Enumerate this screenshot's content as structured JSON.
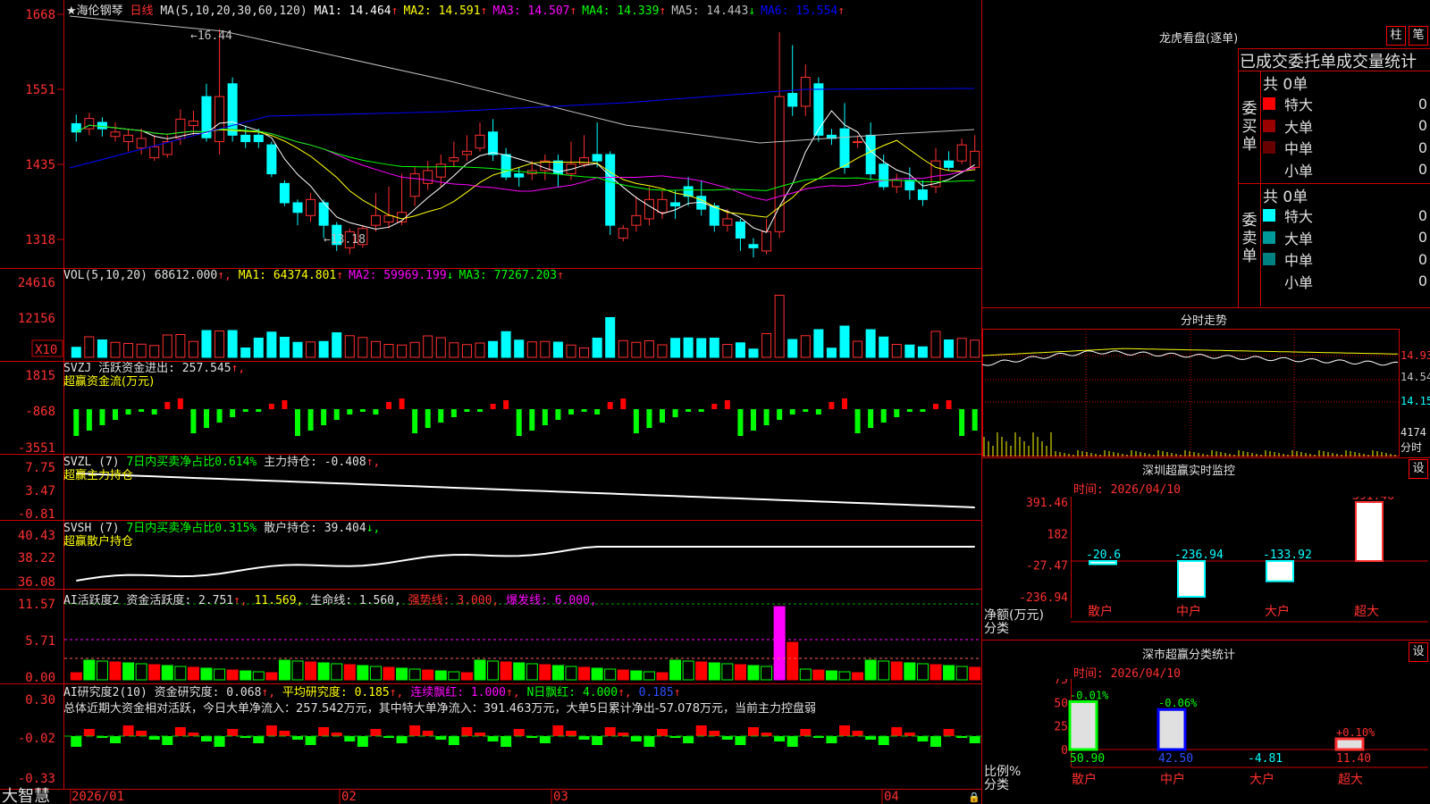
{
  "stock": {
    "name": "★海伦钢琴",
    "period": "日线",
    "ma_params": "MA(5,10,20,30,60,120)",
    "ma": [
      {
        "label": "MA1:",
        "value": "14.464",
        "arrow": "↑",
        "color": "#ffffff"
      },
      {
        "label": "MA2:",
        "value": "14.591",
        "arrow": "↑",
        "color": "#ffff00"
      },
      {
        "label": "MA3:",
        "value": "14.507",
        "arrow": "↑",
        "color": "#ff00ff"
      },
      {
        "label": "MA4:",
        "value": "14.339",
        "arrow": "↑",
        "color": "#00ff00"
      },
      {
        "label": "MA5:",
        "value": "14.443",
        "arrow": "↓",
        "color": "#c0c0c0"
      },
      {
        "label": "MA6:",
        "value": "15.554",
        "arrow": "↑",
        "color": "#0000ff"
      }
    ],
    "price_axis": [
      "1668",
      "1551",
      "1435",
      "1318"
    ],
    "high_marker": "16.44",
    "low_marker": "13.18"
  },
  "vol": {
    "params": "VOL(5,10,20)",
    "value": "68612.000",
    "items": [
      {
        "label": "MA1:",
        "value": "64374.801",
        "arrow": "↑",
        "color": "#ffff00"
      },
      {
        "label": "MA2:",
        "value": "59969.199",
        "arrow": "↓",
        "color": "#ff00ff"
      },
      {
        "label": "MA3:",
        "value": "77267.203",
        "arrow": "↑",
        "color": "#00ff00"
      }
    ],
    "axis": [
      "24616",
      "12156"
    ],
    "unit": "X10"
  },
  "svzj": {
    "line1_a": "SVZJ  活跃资金进出:",
    "line1_b": "257.545",
    "arrow": "↑,",
    "line2": "超赢资金流(万元)",
    "axis": [
      "1815",
      "-868",
      "-3551"
    ]
  },
  "svzl": {
    "prefix": "SVZL (7)",
    "desc": "7日内买卖净占比0.614%",
    "holding_label": "主力持仓:",
    "holding_value": "-0.408",
    "arrow": "↑,",
    "line2": "超赢主力持仓",
    "axis": [
      "7.75",
      "3.47",
      "-0.81"
    ]
  },
  "svsh": {
    "prefix": "SVSH (7)",
    "desc": "7日内买卖净占比0.315%",
    "holding_label": "散户持仓:",
    "holding_value": "39.404",
    "arrow": "↓,",
    "line2": "超赢散户持仓",
    "axis": [
      "40.43",
      "38.22",
      "36.08"
    ]
  },
  "ai1": {
    "title": "AI活跃度2",
    "label": "资金活跃度:",
    "value": "2.751",
    "v2": "11.569,",
    "life": "生命线: 1.560,",
    "strong": "强势线: 3.000,",
    "burst": "爆发线: 6.000,",
    "axis": [
      "11.57",
      "5.71",
      "0.00"
    ]
  },
  "ai2": {
    "title": "AI研究度2(10)",
    "label": "资金研究度:",
    "value": "0.068",
    "avg_label": "平均研究度:",
    "avg_value": "0.185",
    "red_label": "连续飘红:",
    "red_value": "1.000",
    "n_label": "N日飘红:",
    "n_value": "4.000",
    "last_value": "0.185",
    "summary": "总体近期大资金相对活跃，今日大单净流入：257.542万元，其中特大单净流入：391.463万元，大单5日累计净出-57.078万元，当前主力控盘弱",
    "axis": [
      "0.30",
      "-0.02",
      "-0.33"
    ]
  },
  "date_axis": {
    "brand": "大智慧",
    "labels": [
      "2026/01",
      "02",
      "03",
      "04"
    ]
  },
  "longhu": {
    "title": "龙虎看盘(逐单)",
    "btn1": "柱",
    "btn2": "笔",
    "header": "已成交委托单成交量统计",
    "buy_label": [
      "委",
      "买",
      "单"
    ],
    "sell_label": [
      "委",
      "卖",
      "单"
    ],
    "buy_total": "共 0单",
    "sell_total": "共 0单",
    "buy_rows": [
      {
        "name": "特大",
        "count": "0",
        "pct": "0%",
        "color": "#ff0000"
      },
      {
        "name": "大单",
        "count": "0",
        "pct": "0%",
        "color": "#990000"
      },
      {
        "name": "中单",
        "count": "0",
        "pct": "0%",
        "color": "#660000"
      },
      {
        "name": "小单",
        "count": "0",
        "pct": "0%",
        "color": "#000000"
      }
    ],
    "sell_rows": [
      {
        "name": "特大",
        "count": "0",
        "pct": "0%",
        "color": "#00ffff"
      },
      {
        "name": "大单",
        "count": "0",
        "pct": "0%",
        "color": "#009999"
      },
      {
        "name": "中单",
        "count": "0",
        "pct": "0%",
        "color": "#008080"
      },
      {
        "name": "小单",
        "count": "0",
        "pct": "0%",
        "color": "#000000"
      }
    ]
  },
  "fenshi": {
    "title": "分时走势",
    "axis": [
      "14.93",
      "14.54",
      "14.15"
    ],
    "vol_label": "4174",
    "vol_unit": "分时"
  },
  "sz_monitor": {
    "title": "深圳超赢实时监控",
    "btn": "设",
    "time": "时间: 2026/04/10",
    "ylabel": "净额(万元)",
    "xlabel": "分类",
    "axis": [
      "391.46",
      "182",
      "-27.47",
      "-236.94"
    ],
    "categories": [
      "散户",
      "中户",
      "大户",
      "超大"
    ],
    "values": [
      "-20.6",
      "-236.94",
      "-133.92",
      "391.46"
    ]
  },
  "sz_class": {
    "title": "深市超赢分类统计",
    "btn": "设",
    "time": "时间: 2026/04/10",
    "ylabel": "比例%",
    "xlabel": "分类",
    "axis": [
      "75",
      "50",
      "25",
      "0"
    ],
    "categories": [
      "散户",
      "中户",
      "大户",
      "超大"
    ],
    "values": [
      "50.90",
      "42.50",
      "-4.81",
      "11.40"
    ],
    "changes": [
      "-0.01%",
      "-0.06%",
      "",
      "+0.10%"
    ]
  },
  "chart_data": [
    {
      "type": "candlestick",
      "title": "海伦钢琴 日线",
      "y_axis_ticks": [
        13.18,
        14.35,
        15.51,
        16.68
      ],
      "high": 16.44,
      "low": 13.18,
      "x_tick_labels": [
        "2026/01",
        "02",
        "03",
        "04"
      ]
    },
    {
      "type": "bar",
      "title": "深圳超赢实时监控",
      "categories": [
        "散户",
        "中户",
        "大户",
        "超大"
      ],
      "values": [
        -20.6,
        -236.94,
        -133.92,
        391.46
      ],
      "ylabel": "净额(万元)",
      "xlabel": "分类",
      "ylim": [
        -236.94,
        391.46
      ]
    },
    {
      "type": "bar",
      "title": "深市超赢分类统计",
      "categories": [
        "散户",
        "中户",
        "大户",
        "超大"
      ],
      "values": [
        50.9,
        42.5,
        -4.81,
        11.4
      ],
      "ylabel": "比例%",
      "xlabel": "分类",
      "ylim": [
        0,
        75
      ]
    }
  ]
}
